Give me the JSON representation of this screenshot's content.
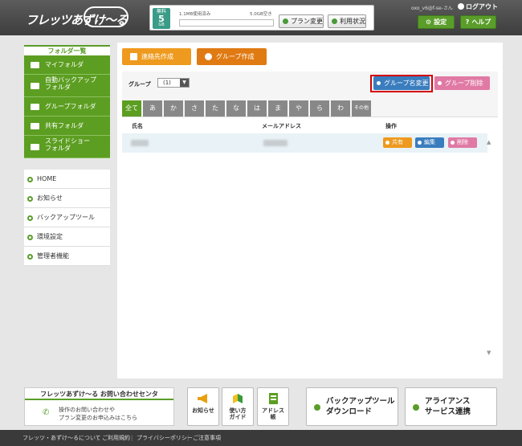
{
  "header": {
    "logo": "フレッツあずけ〜る",
    "plan": {
      "badge_top": "無料",
      "badge_num": "5",
      "badge_unit": "GB",
      "used": "1.1MB使用済み",
      "free": "5.0GB空き"
    },
    "plan_change": "プラン変更",
    "usage_status": "利用状況",
    "user": "oxo_v6@f-se-さん",
    "logout": "ログアウト",
    "settings": "設定",
    "help": "ヘルプ"
  },
  "sidebar": {
    "folder_heading": "フォルダ一覧",
    "folders": [
      "マイフォルダ",
      "自動バックアップフォルダ",
      "グループフォルダ",
      "共有フォルダ",
      "スライドショーフォルダ"
    ],
    "folder_line1": [
      "マイフォルダ",
      "自動バックアップ",
      "グループフォルダ",
      "共有フォルダ",
      "スライドショー"
    ],
    "folder_line2": [
      "",
      "フォルダ",
      "",
      "",
      "フォルダ"
    ],
    "nav": [
      "HOME",
      "お知らせ",
      "バックアップツール",
      "環境設定",
      "管理者機能"
    ]
  },
  "toolbar": {
    "create_contact": "連絡先作成",
    "create_group": "グループ作成"
  },
  "group": {
    "label": "グループ",
    "selected": "(1)",
    "rename": "グループ名変更",
    "delete": "グループ削除"
  },
  "tabs": [
    "全て",
    "あ",
    "か",
    "さ",
    "た",
    "な",
    "は",
    "ま",
    "や",
    "ら",
    "わ",
    "その他"
  ],
  "table": {
    "columns": [
      "氏名",
      "メールアドレス",
      "操作"
    ],
    "row_actions": [
      "共有",
      "編集",
      "削除"
    ]
  },
  "footer_panel": {
    "contact_title": "フレッツあずけ〜る お問い合わせセンタ",
    "contact_line1": "操作のお問い合わせや",
    "contact_line2": "プラン変更のお申込みはこちら",
    "notice": "お知らせ",
    "guide": [
      "使い方",
      "ガイド"
    ],
    "address": [
      "アドレス",
      "帳"
    ],
    "backup_tool": [
      "バックアップツール",
      "ダウンロード"
    ],
    "alliance": [
      "アライアンス",
      "サービス連携"
    ]
  },
  "footer_links": [
    "フレッツ・あずけ〜るについて",
    "ご利用規約",
    "プライバシーポリシー",
    "ご注意事項"
  ],
  "colors": {
    "green": "#5c9e21",
    "orange": "#ee9a1e",
    "blue": "#3a7dbe",
    "pink": "#e07aa5",
    "highlight": "#d40000"
  }
}
